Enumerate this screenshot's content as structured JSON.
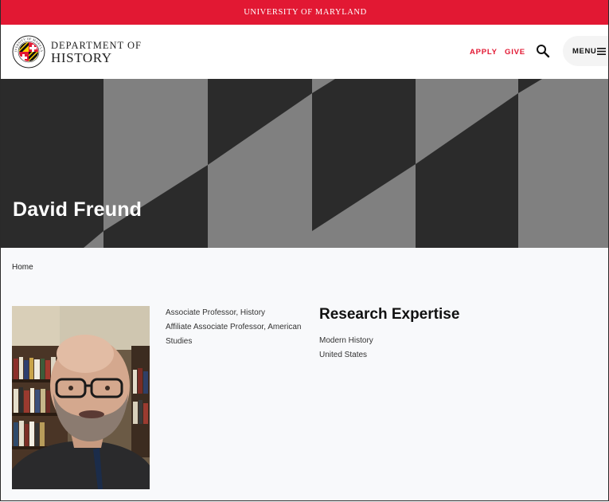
{
  "top_bar": {
    "label": "UNIVERSITY OF MARYLAND"
  },
  "header": {
    "dept_line1": "DEPARTMENT OF",
    "dept_line2": "HISTORY",
    "seal_text": "UNIVERSITY OF MARYLAND",
    "nav": [
      {
        "label": "APPLY"
      },
      {
        "label": "GIVE"
      }
    ],
    "menu_label": "MENU",
    "icons": {
      "search": "search-icon",
      "menu": "hamburger-icon",
      "seal": "umd-seal-icon"
    }
  },
  "hero": {
    "title": "David Freund"
  },
  "breadcrumb": {
    "home": "Home"
  },
  "profile": {
    "titles": [
      "Associate Professor, History",
      "Affiliate Associate Professor, American Studies"
    ]
  },
  "research": {
    "heading": "Research Expertise",
    "items": [
      "Modern History",
      "United States"
    ]
  },
  "colors": {
    "brand_red": "#e21833",
    "hero_dark": "#2b2b2b",
    "hero_light": "#808080",
    "gold": "#ffd200"
  }
}
